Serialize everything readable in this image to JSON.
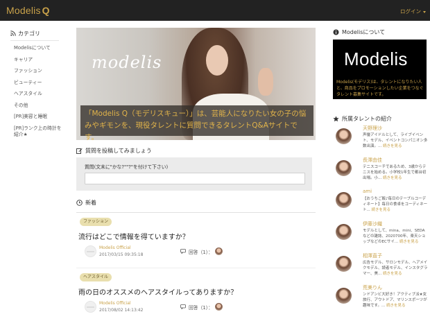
{
  "navbar": {
    "brand_text": "Modelis",
    "brand_q": "Q",
    "login_label": "ログイン"
  },
  "left_sidebar": {
    "heading": "カテゴリ",
    "heading_icon": "rss-icon",
    "items": [
      "Modelisについて",
      "キャリア",
      "ファッション",
      "ビューティー",
      "ヘアスタイル",
      "その他",
      "[PR]美容と睡眠",
      "[PR]ランク上の時計を紹介★"
    ]
  },
  "hero": {
    "logo_text": "modelis",
    "caption": "「Modelis Q（モデリスキュー）」は、芸能人になりたい女の子の悩みやギモンを、現役タレントに質問できるタレントQ&Aサイトです。"
  },
  "ask": {
    "heading": "質問を投稿してみましょう",
    "heading_icon": "edit-icon",
    "label": "質問(文末に\"かな?\"\"?\"を付けて下さい)"
  },
  "new_section": {
    "heading": "新着",
    "heading_icon": "clock-icon"
  },
  "questions": [
    {
      "tag": "ファッション",
      "title": "流行はどこで情報を得ていますか？",
      "author": "Modelis Official",
      "date": "2017/03/15 09:35:18",
      "answer_label": "回答（1）："
    },
    {
      "tag": "ヘアスタイル",
      "title": "雨の日のオススメのヘアスタイルってありますか？",
      "author": "Modelis Official",
      "date": "2017/08/02 14:13:42",
      "answer_label": "回答（1）："
    }
  ],
  "about": {
    "heading": "Modelisについて",
    "heading_icon": "info-circle-icon",
    "logo_text": "Modelis",
    "text": "Modelis(モデリス)は、タレントになりたい人と、商品をプロモーションしたい企業をつなぐタレント募集サイトです。"
  },
  "talents_section": {
    "heading": "所属タレントの紹介",
    "heading_icon": "star-icon",
    "more_label": "続きを見る",
    "items": [
      {
        "name": "天野理沙",
        "desc": "声優アイドルとして、ライブイベント、モデル、イベントコンパニオン多数出演。... "
      },
      {
        "name": "長澤由佳",
        "desc": "テニスコーチであるため、3歳からテニスを始める。小学校1年生で都台初出場。小... "
      },
      {
        "name": "ami",
        "desc": "【おうちご飯♪毎日のテーブルコーディネート】毎日の食卓をコーディネート... "
      },
      {
        "name": "伊藤沙織",
        "desc": "モデルとして、mina、mini、SEDAなどの雑誌、2020700年、楽天ショップなどのECサイ... "
      },
      {
        "name": "相澤直子",
        "desc": "広告モデル、サロンモデル、ヘアメイクモデル、読者モデル、インスタグラマー、美... "
      },
      {
        "name": "荒美りん",
        "desc": "ンドアンビ大好き！アクティブ派★女 旅行、アウトドア、マリンスポーツが趣味です。... "
      }
    ]
  },
  "colors": {
    "accent": "#c9a24a",
    "navbar": "#222222",
    "tag_bg": "#e9dfae"
  }
}
